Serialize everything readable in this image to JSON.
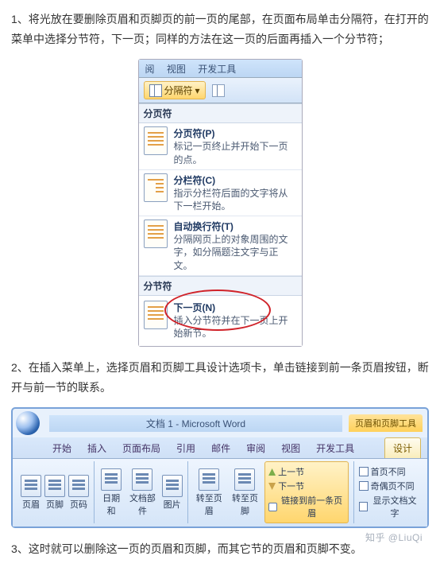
{
  "paragraphs": {
    "p1": "1、将光放在要删除页眉和页脚页的前一页的尾部，在页面布局单击分隔符，在打开的菜单中选择分节符，下一页；同样的方法在这一页的后面再插入一个分节符；",
    "p2": "2、在插入菜单上，选择页眉和页脚工具设计选项卡，单击链接到前一条页眉按钮，断开与前一节的联系。",
    "p3": "3、这时就可以删除这一页的页眉和页脚，而其它节的页眉和页脚不变。"
  },
  "dropdown": {
    "tabs": {
      "a": "阅",
      "b": "视图",
      "c": "开发工具"
    },
    "btn": "分隔符",
    "section1": {
      "header": "分页符",
      "i1": {
        "title": "分页符(P)",
        "desc": "标记一页终止并开始下一页的点。"
      },
      "i2": {
        "title": "分栏符(C)",
        "desc": "指示分栏符后面的文字将从下一栏开始。"
      },
      "i3": {
        "title": "自动换行符(T)",
        "desc": "分隔网页上的对象周围的文字，如分隔题注文字与正文。"
      }
    },
    "section2": {
      "header": "分节符",
      "i1": {
        "title": "下一页(N)",
        "desc": "插入分节符并在下一页上开始新节。"
      }
    }
  },
  "ribbon": {
    "title": "文档 1 - Microsoft Word",
    "context": "页眉和页脚工具",
    "tabs": {
      "t1": "开始",
      "t2": "插入",
      "t3": "页面布局",
      "t4": "引用",
      "t5": "邮件",
      "t6": "审阅",
      "t7": "视图",
      "t8": "开发工具",
      "active": "设计"
    },
    "groups": {
      "g1a": "页眉",
      "g1b": "页脚",
      "g1c": "页码",
      "g2a": "日期和",
      "g2b": "文档部件",
      "g2c": "图片",
      "g3a": "转至页眉",
      "g3b": "转至页脚",
      "nav1": "上一节",
      "nav2": "下一节",
      "nav3": "链接到前一条页眉",
      "opt1": "首页不同",
      "opt2": "奇偶页不同",
      "opt3": "显示文档文字"
    }
  },
  "watermark": "知乎 @LiuQi"
}
